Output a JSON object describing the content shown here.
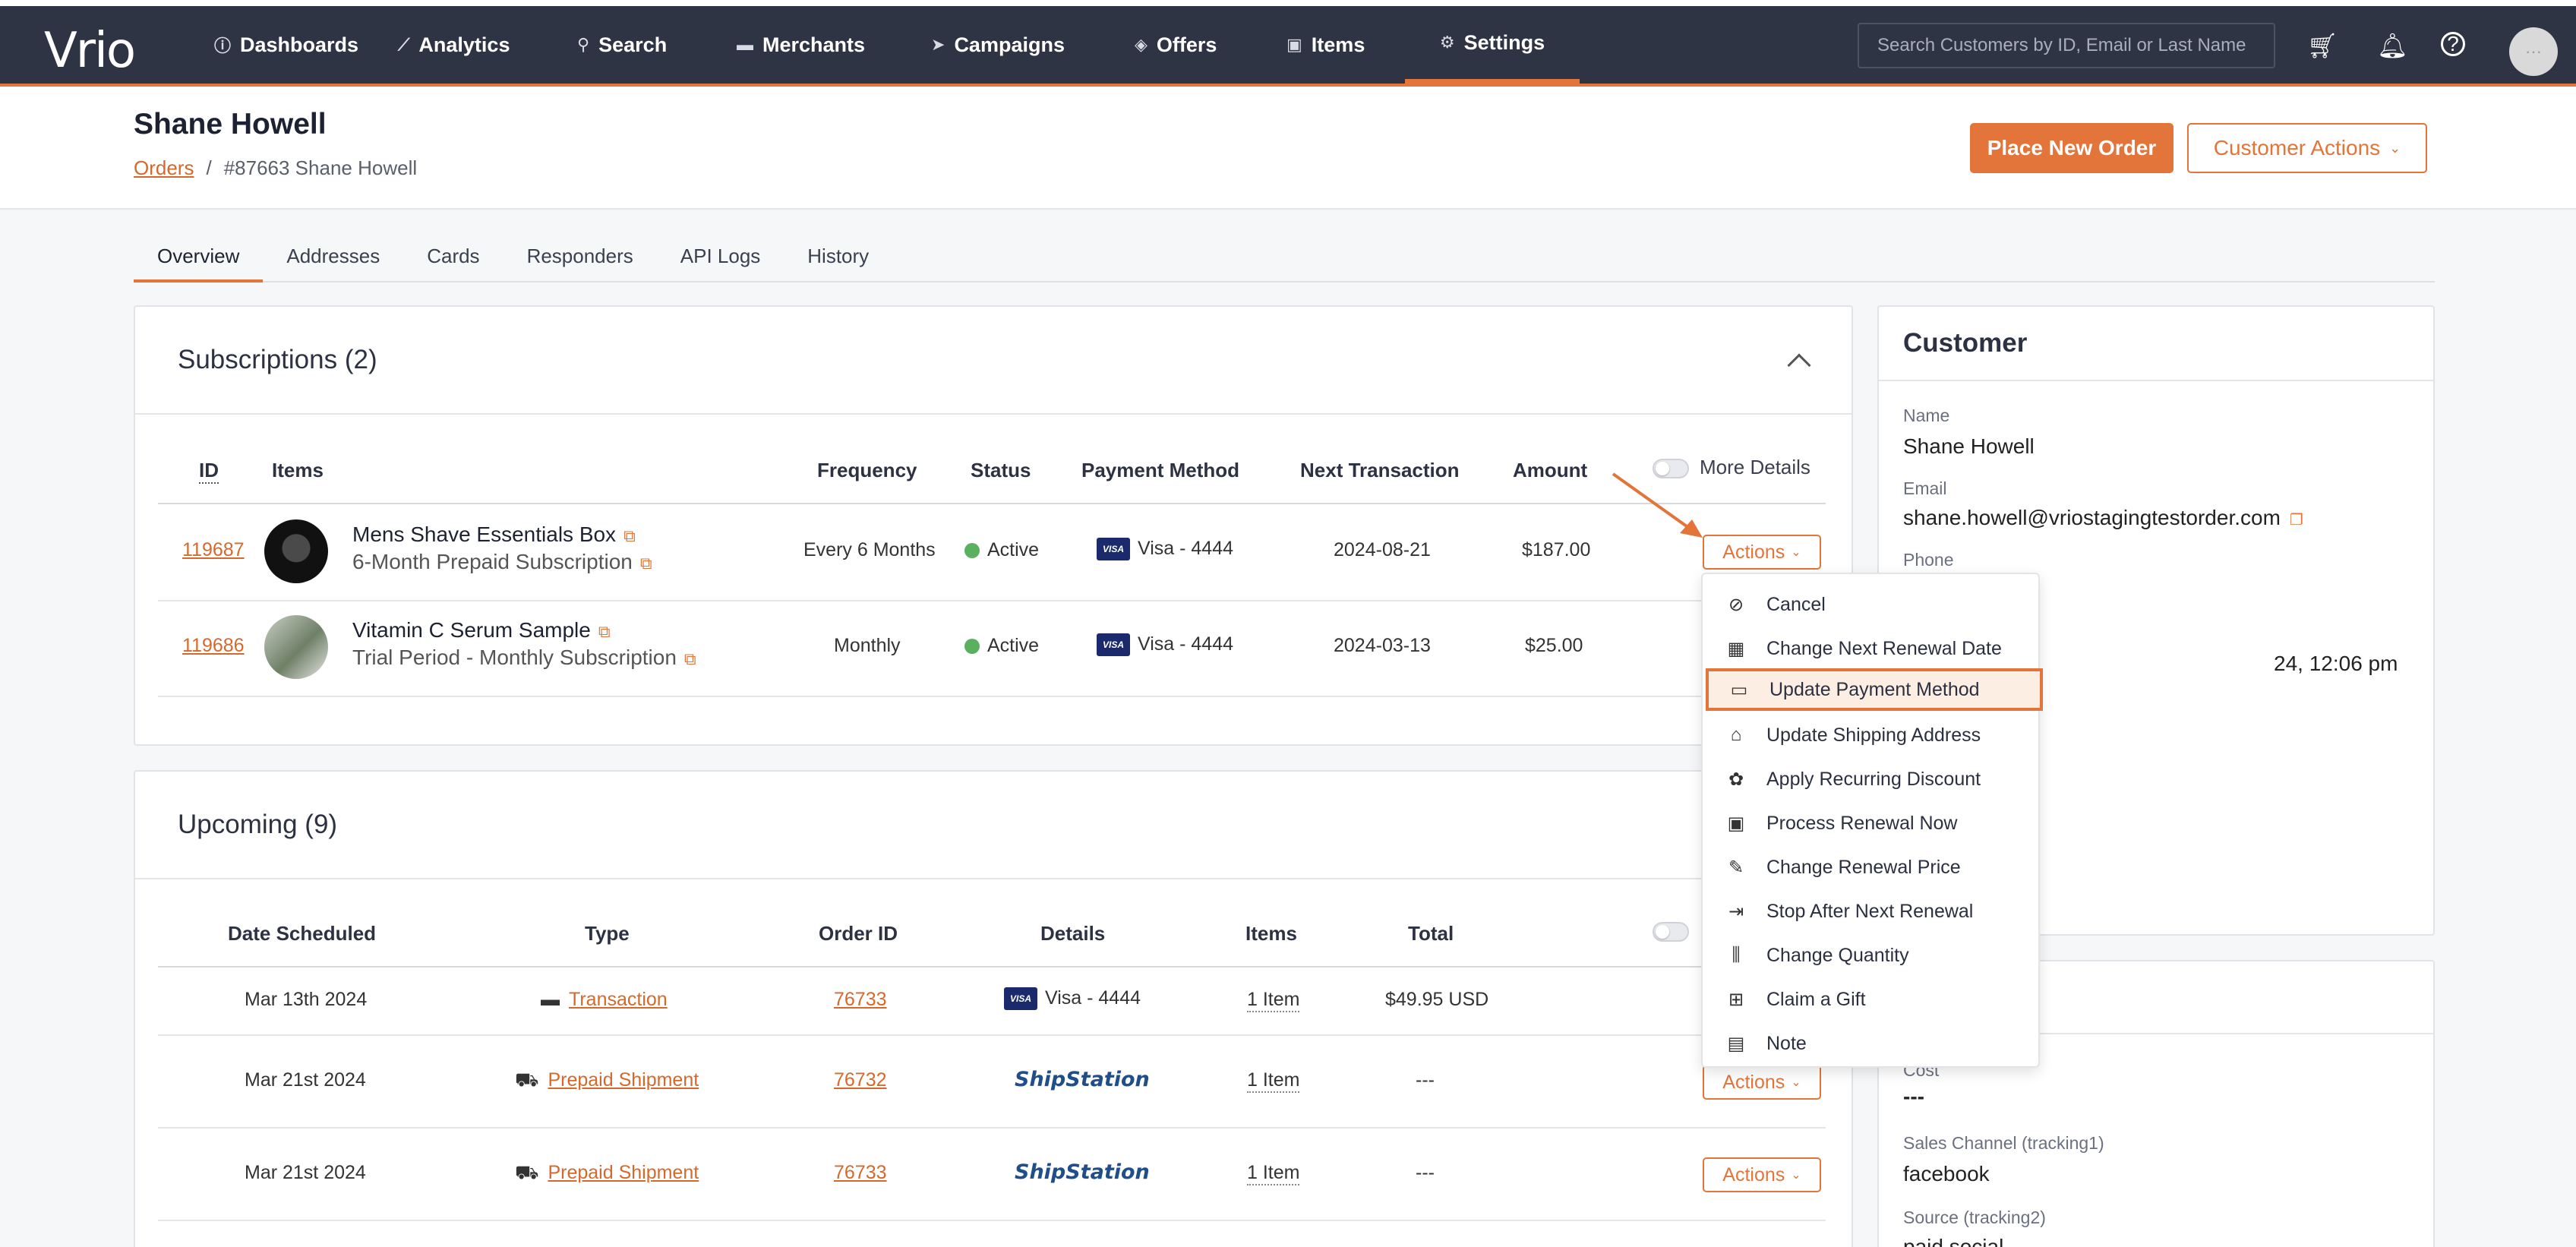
{
  "nav": {
    "logo": "Vrio",
    "items": [
      {
        "label": "Dashboards",
        "icon": "ⓘ"
      },
      {
        "label": "Analytics",
        "icon": "⟋"
      },
      {
        "label": "Search",
        "icon": "⚲"
      },
      {
        "label": "Merchants",
        "icon": "▬"
      },
      {
        "label": "Campaigns",
        "icon": "➤"
      },
      {
        "label": "Offers",
        "icon": "◈"
      },
      {
        "label": "Items",
        "icon": "▣"
      },
      {
        "label": "Settings",
        "icon": "⚙"
      }
    ],
    "search_placeholder": "Search Customers by ID, Email or Last Name"
  },
  "header": {
    "title": "Shane Howell",
    "breadcrumb_link": "Orders",
    "breadcrumb_sep": "/",
    "breadcrumb_current": "#87663 Shane Howell",
    "place_order": "Place New Order",
    "customer_actions": "Customer Actions"
  },
  "tabs": [
    "Overview",
    "Addresses",
    "Cards",
    "Responders",
    "API Logs",
    "History"
  ],
  "subscriptions": {
    "title": "Subscriptions (2)",
    "more_details": "More Details",
    "columns": [
      "ID",
      "Items",
      "Frequency",
      "Status",
      "Payment Method",
      "Next Transaction",
      "Amount"
    ],
    "rows": [
      {
        "id": "119687",
        "name": "Mens Shave Essentials Box",
        "sub": "6-Month Prepaid Subscription",
        "frequency": "Every 6 Months",
        "status": "Active",
        "payment": "Visa - 4444",
        "next": "2024-08-21",
        "amount": "$187.00",
        "actions": "Actions"
      },
      {
        "id": "119686",
        "name": "Vitamin C Serum Sample",
        "sub": "Trial Period - Monthly Subscription",
        "frequency": "Monthly",
        "status": "Active",
        "payment": "Visa - 4444",
        "next": "2024-03-13",
        "amount": "$25.00"
      }
    ]
  },
  "upcoming": {
    "title": "Upcoming (9)",
    "columns": [
      "Date Scheduled",
      "Type",
      "Order ID",
      "Details",
      "Items",
      "Total"
    ],
    "rows": [
      {
        "date": "Mar 13th 2024",
        "type": "Transaction",
        "order": "76733",
        "details": "Visa - 4444",
        "items": "1 Item",
        "total": "$49.95 USD"
      },
      {
        "date": "Mar 21st 2024",
        "type": "Prepaid Shipment",
        "order": "76732",
        "details": "ShipStation",
        "items": "1 Item",
        "total": "---",
        "actions": "Actions"
      },
      {
        "date": "Mar 21st 2024",
        "type": "Prepaid Shipment",
        "order": "76733",
        "details": "ShipStation",
        "items": "1 Item",
        "total": "---",
        "actions": "Actions"
      }
    ]
  },
  "customer": {
    "title": "Customer",
    "name_label": "Name",
    "name": "Shane Howell",
    "email_label": "Email",
    "email": "shane.howell@vriostagingtestorder.com",
    "phone_label": "Phone",
    "date_partial": "24, 12:06 pm"
  },
  "tracking": {
    "cost_label": "Cost",
    "cost": "---",
    "sales_channel_label": "Sales Channel (tracking1)",
    "sales_channel": "facebook",
    "source_label": "Source (tracking2)",
    "source": "paid social"
  },
  "menu": {
    "items": [
      {
        "label": "Cancel",
        "icon": "⊘"
      },
      {
        "label": "Change Next Renewal Date",
        "icon": "▦"
      },
      {
        "label": "Update Payment Method",
        "icon": "▭"
      },
      {
        "label": "Update Shipping Address",
        "icon": "⌂"
      },
      {
        "label": "Apply Recurring Discount",
        "icon": "✿"
      },
      {
        "label": "Process Renewal Now",
        "icon": "▣"
      },
      {
        "label": "Change Renewal Price",
        "icon": "✎"
      },
      {
        "label": "Stop After Next Renewal",
        "icon": "⇥"
      },
      {
        "label": "Change Quantity",
        "icon": "⫼"
      },
      {
        "label": "Claim a Gift",
        "icon": "⊞"
      },
      {
        "label": "Note",
        "icon": "▤"
      }
    ]
  },
  "colors": {
    "accent": "#e3743a",
    "nav_bg": "#2f3445",
    "active": "#5bb05f"
  }
}
